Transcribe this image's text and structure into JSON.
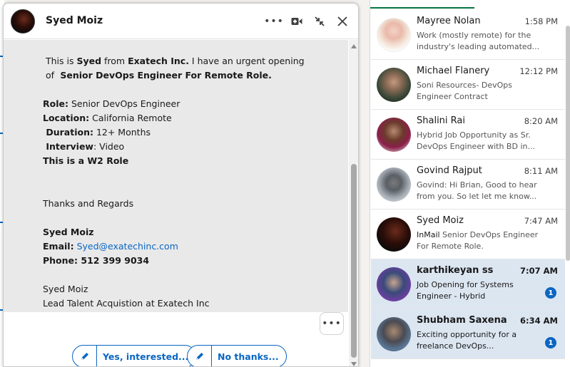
{
  "header": {
    "name": "Syed Moiz",
    "more_icon": "more-horizontal-icon",
    "video_icon": "video-call-icon",
    "minimize_icon": "minimize-icon",
    "close_icon": "close-icon"
  },
  "message": {
    "l1_a": " This is ",
    "l1_b": "Syed",
    "l1_c": " from ",
    "l1_d": "Exatech Inc.",
    "l1_e": " I have an urgent opening",
    "l2_a": " of ",
    "l2_b": " Senior DevOps Engineer For Remote Role.",
    "role_label": "Role:",
    "role_value": " Senior DevOps Engineer",
    "location_label": "Location:",
    "location_value": " California Remote",
    "duration_label": " Duration:",
    "duration_value": " 12+ Months",
    "interview_label": " Interview",
    "interview_value": ": Video",
    "w2": "This is a W2 Role",
    "thanks": "Thanks and Regards",
    "sig_name": "Syed Moiz",
    "email_label": "Email:",
    "email_value": "Syed@exatechinc.com",
    "phone": "Phone: 512 399 9034",
    "sig_name2": "Syed Moiz",
    "sig_title": "Lead Talent Acquistion at Exatech Inc"
  },
  "actions": {
    "more_label": "•••",
    "yes_label": "Yes, interested...",
    "no_label": "No thanks..."
  },
  "conversations": [
    {
      "name": "Mayree Nolan",
      "time": "1:58 PM",
      "tag": "",
      "snippet": "Work (mostly remote) for the industry's leading automated...",
      "unread": false,
      "badge": ""
    },
    {
      "name": "Michael Flanery",
      "time": "12:12 PM",
      "tag": "",
      "snippet": "Soni Resources- DevOps Engineer Contract",
      "unread": false,
      "badge": ""
    },
    {
      "name": "Shalini Rai",
      "time": "8:20 AM",
      "tag": "",
      "snippet": "Hybrid Job Opportunity as Sr. DevOps Engineer with BD in...",
      "unread": false,
      "badge": ""
    },
    {
      "name": "Govind Rajput",
      "time": "8:11 AM",
      "tag": "",
      "snippet": "Govind: Hi Brian, Good to hear from you. So let let me know...",
      "unread": false,
      "badge": ""
    },
    {
      "name": "Syed Moiz",
      "time": "7:47 AM",
      "tag": "InMail",
      "snippet": " Senior DevOps Engineer For Remote Role.",
      "unread": false,
      "badge": ""
    },
    {
      "name": "karthikeyan ss",
      "time": "7:07 AM",
      "tag": "",
      "snippet": "Job Opening for Systems Engineer - Hybrid",
      "unread": true,
      "badge": "1"
    },
    {
      "name": "Shubham Saxena",
      "time": "6:34 AM",
      "tag": "",
      "snippet": "Exciting opportunity for a freelance DevOps...",
      "unread": true,
      "badge": "1"
    }
  ],
  "colors": {
    "accent": "#0a66c2",
    "unread_bg": "#dce6f1",
    "message_bg": "#e9e9e9"
  }
}
